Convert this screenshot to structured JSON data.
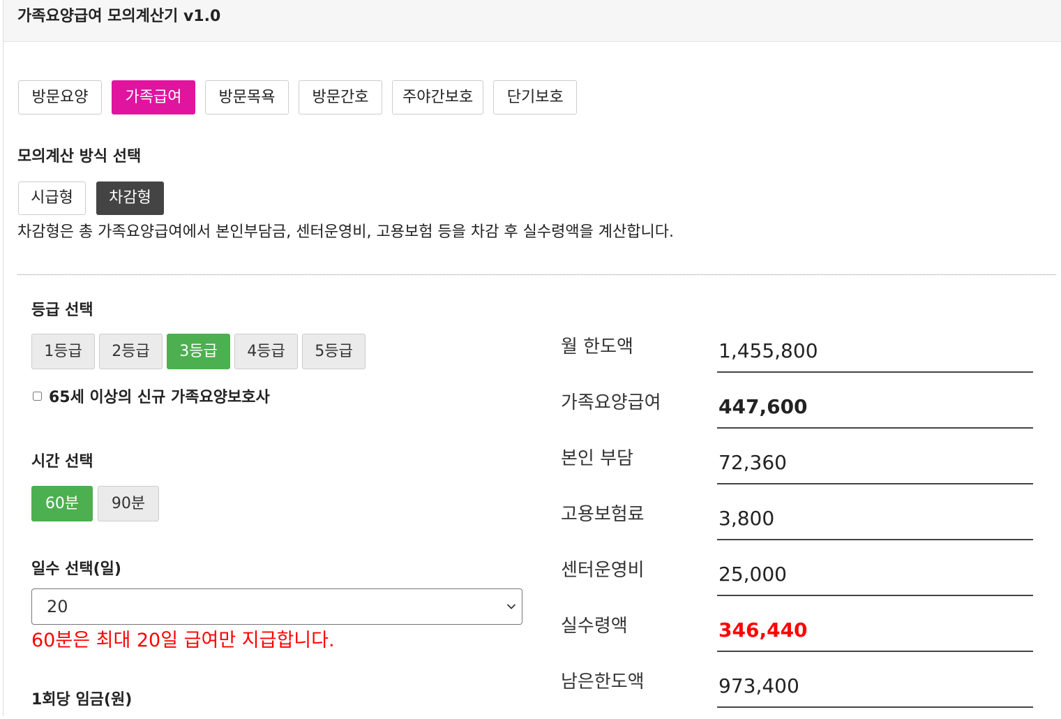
{
  "app": {
    "title": "가족요양급여 모의계산기 v1.0"
  },
  "service_tabs": [
    {
      "label": "방문요양",
      "active": false
    },
    {
      "label": "가족급여",
      "active": true
    },
    {
      "label": "방문목욕",
      "active": false
    },
    {
      "label": "방문간호",
      "active": false
    },
    {
      "label": "주야간보호",
      "active": false
    },
    {
      "label": "단기보호",
      "active": false
    }
  ],
  "method": {
    "heading": "모의계산 방식 선택",
    "options": [
      {
        "label": "시급형",
        "active": false
      },
      {
        "label": "차감형",
        "active": true
      }
    ],
    "description": "차감형은 총 가족요양급여에서 본인부담금, 센터운영비, 고용보험 등을 차감 후 실수령액을 계산합니다."
  },
  "grade": {
    "heading": "등급 선택",
    "options": [
      {
        "label": "1등급",
        "active": false
      },
      {
        "label": "2등급",
        "active": false
      },
      {
        "label": "3등급",
        "active": true
      },
      {
        "label": "4등급",
        "active": false
      },
      {
        "label": "5등급",
        "active": false
      }
    ]
  },
  "new_caregiver": {
    "label": "65세 이상의 신규 가족요양보호사",
    "checked": false
  },
  "time": {
    "heading": "시간 선택",
    "options": [
      {
        "label": "60분",
        "active": true
      },
      {
        "label": "90분",
        "active": false
      }
    ]
  },
  "days": {
    "heading": "일수 선택(일)",
    "selected": "20",
    "arrow_icon": "chevron-down-icon",
    "warning": "60분은 최대 20일 급여만 지급합니다."
  },
  "wage": {
    "heading": "1회당 임금(원)"
  },
  "results": [
    {
      "label": "월 한도액",
      "value": "1,455,800",
      "bold": false,
      "highlight": false
    },
    {
      "label": "가족요양급여",
      "value": "447,600",
      "bold": true,
      "highlight": false
    },
    {
      "label": "본인 부담",
      "value": "72,360",
      "bold": false,
      "highlight": false
    },
    {
      "label": "고용보험료",
      "value": "3,800",
      "bold": false,
      "highlight": false
    },
    {
      "label": "센터운영비",
      "value": "25,000",
      "bold": false,
      "highlight": false
    },
    {
      "label": "실수령액",
      "value": "346,440",
      "bold": true,
      "highlight": true
    },
    {
      "label": "남은한도액",
      "value": "973,400",
      "bold": false,
      "highlight": false
    }
  ],
  "colors": {
    "tab_active": "#e0149f",
    "option_active": "#4caf50",
    "method_active": "#444444",
    "warning_text": "#ff0000",
    "net_pay_text": "#ff0000"
  }
}
